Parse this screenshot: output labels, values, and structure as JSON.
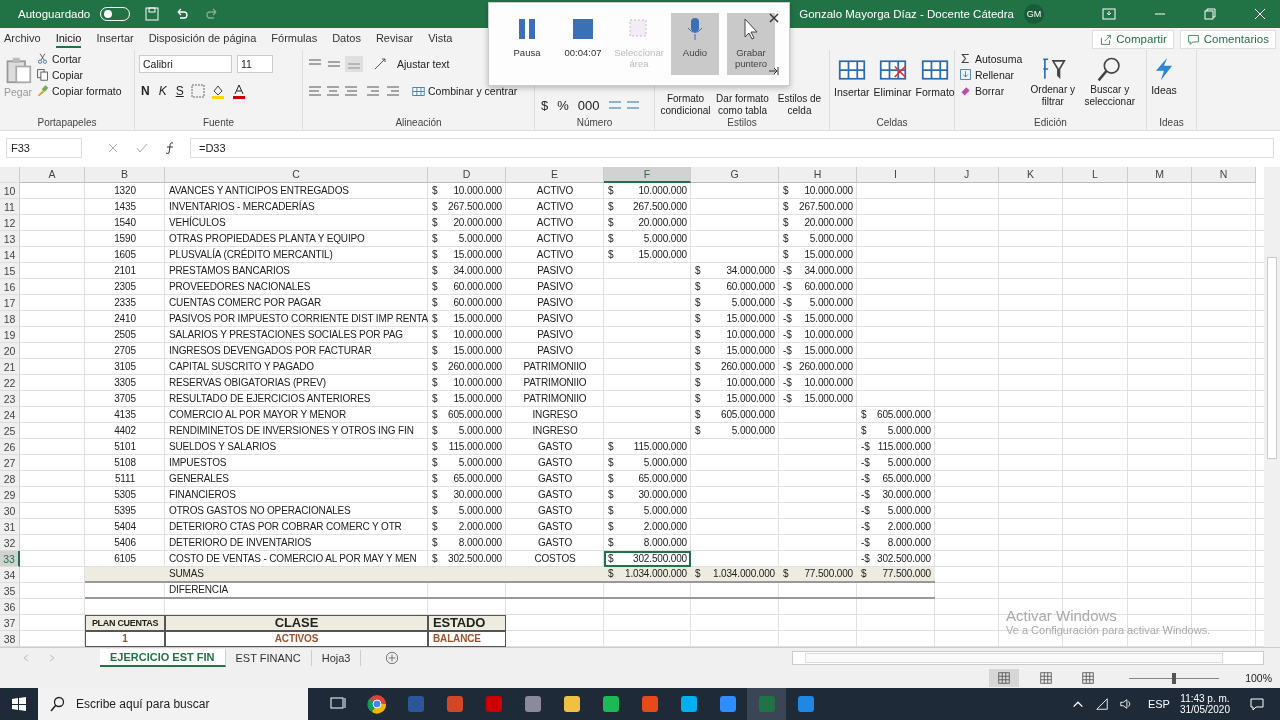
{
  "title_bar": {
    "autosave_label": "Autoguardado",
    "autosave_on": false,
    "user": "Gonzalo Mayorga Díaz - Docente Cátedra",
    "avatar": "GM"
  },
  "tabs": [
    {
      "label": "Archivo",
      "selected": false
    },
    {
      "label": "Inicio",
      "selected": true
    },
    {
      "label": "Insertar",
      "selected": false
    },
    {
      "label": "Disposición de página",
      "selected": false
    },
    {
      "label": "Fórmulas",
      "selected": false
    },
    {
      "label": "Datos",
      "selected": false
    },
    {
      "label": "Revisar",
      "selected": false
    },
    {
      "label": "Vista",
      "selected": false
    }
  ],
  "share_buttons": [
    "Compartir",
    "Comentarios"
  ],
  "ribbon": {
    "clipboard": {
      "label": "Portapapeles",
      "paste": "Pegar",
      "items": [
        "Cortar",
        "Copiar",
        "Copiar formato"
      ]
    },
    "font": {
      "label": "Fuente",
      "family": "Calibri",
      "size": "11",
      "styles": [
        "N",
        "K",
        "S"
      ]
    },
    "alignment": {
      "label": "Alineación",
      "wrap": "Ajustar text",
      "merge": "Combinar y centrar"
    },
    "number": {
      "label": "Número",
      "symbols": [
        "$",
        "%",
        "000"
      ]
    },
    "styles": {
      "label": "Estilos",
      "items": [
        "Formato condicional",
        "Dar formato como tabla",
        "Estilos de celda"
      ]
    },
    "cells": {
      "label": "Celdas",
      "items": [
        "Insertar",
        "Eliminar",
        "Formato"
      ]
    },
    "editing": {
      "label": "Edición",
      "small": [
        "Autosuma",
        "Rellenar",
        "Borrar"
      ],
      "large": [
        "Ordenar y filtrar",
        "Buscar y seleccionar"
      ]
    },
    "ideas": {
      "label": "Ideas",
      "button": "Ideas"
    }
  },
  "recorder": {
    "buttons": [
      {
        "label": "Pausa",
        "kind": "pause",
        "on": false,
        "disabled": false
      },
      {
        "label": "00:04:07",
        "kind": "stop",
        "on": false,
        "disabled": false
      },
      {
        "label": "Seleccionar área",
        "kind": "area",
        "on": false,
        "disabled": true
      },
      {
        "label": "Audio",
        "kind": "mic",
        "on": true,
        "disabled": false
      },
      {
        "label": "Grabar puntero",
        "kind": "pointer",
        "on": true,
        "disabled": false
      }
    ]
  },
  "formula_bar": {
    "name_box": "F33",
    "formula": "=D33"
  },
  "columns": [
    {
      "label": "A",
      "selected": false
    },
    {
      "label": "B",
      "selected": false
    },
    {
      "label": "C",
      "selected": false
    },
    {
      "label": "D",
      "selected": false
    },
    {
      "label": "E",
      "selected": false
    },
    {
      "label": "F",
      "selected": true
    },
    {
      "label": "G",
      "selected": false
    },
    {
      "label": "H",
      "selected": false
    },
    {
      "label": "I",
      "selected": false
    },
    {
      "label": "J",
      "selected": false
    },
    {
      "label": "K",
      "selected": false
    },
    {
      "label": "L",
      "selected": false
    },
    {
      "label": "M",
      "selected": false
    },
    {
      "label": "N",
      "selected": false
    }
  ],
  "rows": [
    {
      "number": "10",
      "kind": "account",
      "selected": false,
      "cells": {
        "B": "1320",
        "C": "AVANCES Y ANTICIPOS ENTREGADOS",
        "D": "$ 10.000.000",
        "E": "ACTIVO",
        "F": "$ 10.000.000",
        "H": "$ 10.000.000"
      }
    },
    {
      "number": "11",
      "kind": "account",
      "selected": false,
      "cells": {
        "B": "1435",
        "C": "INVENTARIOS - MERCADERÍAS",
        "D": "$ 267.500.000",
        "E": "ACTIVO",
        "F": "$ 267.500.000",
        "H": "$ 267.500.000"
      }
    },
    {
      "number": "12",
      "kind": "account",
      "selected": false,
      "cells": {
        "B": "1540",
        "C": "VEHÍCULOS",
        "D": "$ 20.000.000",
        "E": "ACTIVO",
        "F": "$ 20.000.000",
        "H": "$ 20.000.000"
      }
    },
    {
      "number": "13",
      "kind": "account",
      "selected": false,
      "cells": {
        "B": "1590",
        "C": "OTRAS PROPIEDADES PLANTA Y EQUIPO",
        "D": "$ 5.000.000",
        "E": "ACTIVO",
        "F": "$ 5.000.000",
        "H": "$ 5.000.000"
      }
    },
    {
      "number": "14",
      "kind": "account",
      "selected": false,
      "cells": {
        "B": "1605",
        "C": "PLUSVALÍA (CRÉDITO MERCANTIL)",
        "D": "$ 15.000.000",
        "E": "ACTIVO",
        "F": "$ 15.000.000",
        "H": "$ 15.000.000"
      }
    },
    {
      "number": "15",
      "kind": "account",
      "selected": false,
      "cells": {
        "B": "2101",
        "C": "PRESTAMOS BANCARIOS",
        "D": "$ 34.000.000",
        "E": "PASIVO",
        "G": "$ 34.000.000",
        "H": "-$ 34.000.000"
      }
    },
    {
      "number": "16",
      "kind": "account",
      "selected": false,
      "cells": {
        "B": "2305",
        "C": "PROVEEDORES NACIONALES",
        "D": "$ 60.000.000",
        "E": "PASIVO",
        "G": "$ 60.000.000",
        "H": "-$ 60.000.000"
      }
    },
    {
      "number": "17",
      "kind": "account",
      "selected": false,
      "cells": {
        "B": "2335",
        "C": "CUENTAS COMERC POR PAGAR",
        "D": "$ 60.000.000",
        "E": "PASIVO",
        "G": "$ 5.000.000",
        "H": "-$ 5.000.000"
      }
    },
    {
      "number": "18",
      "kind": "account",
      "selected": false,
      "cells": {
        "B": "2410",
        "C": "PASIVOS POR IMPUESTO CORRIENTE DIST IMP RENTA",
        "D": "$ 15.000.000",
        "E": "PASIVO",
        "G": "$ 15.000.000",
        "H": "-$ 15.000.000"
      }
    },
    {
      "number": "19",
      "kind": "account",
      "selected": false,
      "cells": {
        "B": "2505",
        "C": "SALARIOS Y PRESTACIONES SOCIALES POR PAG",
        "D": "$ 10.000.000",
        "E": "PASIVO",
        "G": "$ 10.000.000",
        "H": "-$ 10.000.000"
      }
    },
    {
      "number": "20",
      "kind": "account",
      "selected": false,
      "cells": {
        "B": "2705",
        "C": "INGRESOS DEVENGADOS POR FACTURAR",
        "D": "$ 15.000.000",
        "E": "PASIVO",
        "G": "$ 15.000.000",
        "H": "-$ 15.000.000"
      }
    },
    {
      "number": "21",
      "kind": "account",
      "selected": false,
      "cells": {
        "B": "3105",
        "C": "CAPITAL SUSCRITO Y PAGADO",
        "D": "$ 260.000.000",
        "E": "PATRIMONIIO",
        "G": "$ 260.000.000",
        "H": "-$ 260.000.000"
      }
    },
    {
      "number": "22",
      "kind": "account",
      "selected": false,
      "cells": {
        "B": "3305",
        "C": "RESERVAS OBIGATORIAS (PREV)",
        "D": "$ 10.000.000",
        "E": "PATRIMONIIO",
        "G": "$ 10.000.000",
        "H": "-$ 10.000.000"
      }
    },
    {
      "number": "23",
      "kind": "account",
      "selected": false,
      "cells": {
        "B": "3705",
        "C": "RESULTADO DE EJERCICIOS ANTERIORES",
        "D": "$ 15.000.000",
        "E": "PATRIMONIIO",
        "G": "$ 15.000.000",
        "H": "-$ 15.000.000"
      }
    },
    {
      "number": "24",
      "kind": "account",
      "selected": false,
      "cells": {
        "B": "4135",
        "C": "COMERCIO AL POR MAYOR Y MENOR",
        "D": "$ 605.000.000",
        "E": "INGRESO",
        "G": "$ 605.000.000",
        "I": "$ 605.000.000"
      }
    },
    {
      "number": "25",
      "kind": "account",
      "selected": false,
      "cells": {
        "B": "4402",
        "C": "RENDIMINETOS DE INVERSIONES Y OTROS ING FIN",
        "D": "$ 5.000.000",
        "E": "INGRESO",
        "G": "$ 5.000.000",
        "I": "$ 5.000.000"
      }
    },
    {
      "number": "26",
      "kind": "account",
      "selected": false,
      "cells": {
        "B": "5101",
        "C": "SUELDOS Y SALARIOS",
        "D": "$ 115.000.000",
        "E": "GASTO",
        "F": "$ 115.000.000",
        "I": "-$ 115.000.000"
      }
    },
    {
      "number": "27",
      "kind": "account",
      "selected": false,
      "cells": {
        "B": "5108",
        "C": "IMPUESTOS",
        "D": "$ 5.000.000",
        "E": "GASTO",
        "F": "$ 5.000.000",
        "I": "-$ 5.000.000"
      }
    },
    {
      "number": "28",
      "kind": "account",
      "selected": false,
      "cells": {
        "B": "5111",
        "C": "GENERALES",
        "D": "$ 65.000.000",
        "E": "GASTO",
        "F": "$ 65.000.000",
        "I": "-$ 65.000.000"
      }
    },
    {
      "number": "29",
      "kind": "account",
      "selected": false,
      "cells": {
        "B": "5305",
        "C": "FINANCIEROS",
        "D": "$ 30.000.000",
        "E": "GASTO",
        "F": "$ 30.000.000",
        "I": "-$ 30.000.000"
      }
    },
    {
      "number": "30",
      "kind": "account",
      "selected": false,
      "cells": {
        "B": "5395",
        "C": "OTROS GASTOS NO OPERACIONALES",
        "D": "$ 5.000.000",
        "E": "GASTO",
        "F": "$ 5.000.000",
        "I": "-$ 5.000.000"
      }
    },
    {
      "number": "31",
      "kind": "account",
      "selected": false,
      "cells": {
        "B": "5404",
        "C": "DETERIORO CTAS POR COBRAR COMERC Y OTR",
        "D": "$ 2.000.000",
        "E": "GASTO",
        "F": "$ 2.000.000",
        "I": "-$ 2.000.000"
      }
    },
    {
      "number": "32",
      "kind": "account",
      "selected": false,
      "cells": {
        "B": "5406",
        "C": "DETERIORO DE INVENTARIOS",
        "D": "$ 8.000.000",
        "E": "GASTO",
        "F": "$ 8.000.000",
        "I": "-$ 8.000.000"
      }
    },
    {
      "number": "33",
      "kind": "account",
      "selected": true,
      "cells": {
        "B": "6105",
        "C": "COSTO DE VENTAS - COMERCIO AL POR MAY Y MEN",
        "D": "$ 302.500.000",
        "E": "COSTOS",
        "F": "$ 302.500.000",
        "I": "-$ 302.500.000"
      }
    },
    {
      "number": "34",
      "kind": "total",
      "selected": false,
      "cells": {
        "C": "SUMAS",
        "F": "$ 1.034.000.000",
        "G": "$ 1.034.000.000",
        "H": "$ 77.500.000",
        "I": "$ 77.500.000"
      }
    },
    {
      "number": "35",
      "kind": "label",
      "selected": false,
      "cells": {
        "C": "DIFERENCIA"
      }
    },
    {
      "number": "36",
      "kind": "blank",
      "selected": false,
      "cells": {}
    },
    {
      "number": "37",
      "kind": "header",
      "selected": false,
      "cells": {
        "B": "PLAN CUENTAS",
        "C": "CLASE",
        "D": "ESTADO"
      }
    },
    {
      "number": "38",
      "kind": "class",
      "selected": false,
      "cells": {
        "B": "1",
        "C": "ACTIVOS",
        "D": "BALANCE"
      }
    }
  ],
  "sheet_tabs": [
    {
      "label": "EJERCICIO EST FIN",
      "selected": true
    },
    {
      "label": "EST FINANC",
      "selected": false
    },
    {
      "label": "Hoja3",
      "selected": false
    }
  ],
  "activation": {
    "title": "Activar Windows",
    "hint": "Ve a Configuración para activar Windows."
  },
  "status_bar": {
    "zoom": "100%",
    "zoom_slider": {
      "level": 0.5
    }
  },
  "taskbar": {
    "search_placeholder": "Escribe aquí para buscar",
    "language": "ESP",
    "time": "11:43 p. m.",
    "date": "31/05/2020"
  }
}
